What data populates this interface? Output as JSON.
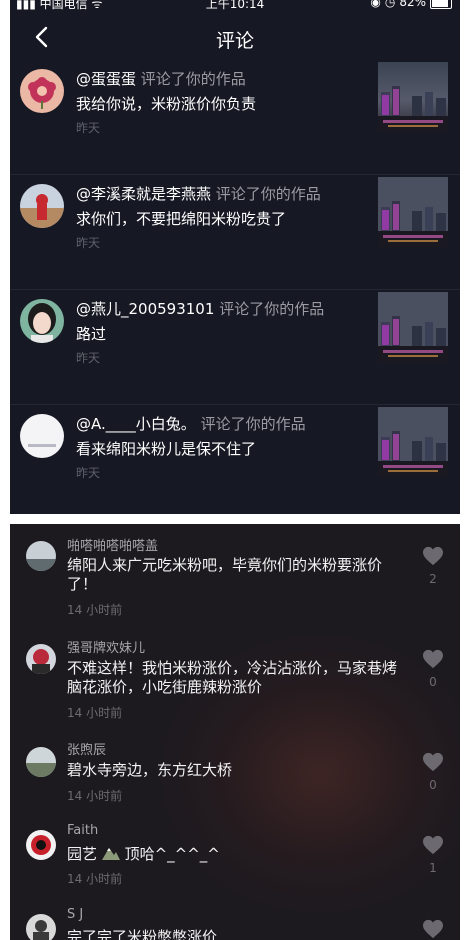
{
  "status_bar": {
    "carrier": "中国电信",
    "time": "上午10:14",
    "battery": "82%"
  },
  "header": {
    "title": "评论"
  },
  "notifications": [
    {
      "user": "@蛋蛋蛋",
      "action": "评论了你的作品",
      "comment": "我给你说，米粉涨价你负责",
      "time": "昨天"
    },
    {
      "user": "@李溪柔就是李燕燕",
      "action": "评论了你的作品",
      "comment": "求你们，不要把绵阳米粉吃贵了",
      "time": "昨天"
    },
    {
      "user": "@燕儿_200593101",
      "action": "评论了你的作品",
      "comment": "路过",
      "time": "昨天"
    },
    {
      "user": "@A.____小白兔。",
      "action": "评论了你的作品",
      "comment": "看来绵阳米粉儿是保不住了",
      "time": "昨天"
    }
  ],
  "comments": [
    {
      "name": "啪嗒啪嗒啪嗒盖",
      "text": "绵阳人来广元吃米粉吧，毕竟你们的米粉要涨价了！",
      "time": "14 小时前",
      "likes": "2"
    },
    {
      "name": "强哥牌欢妹儿",
      "text": "不难这样！我怕米粉涨价，冷沾沾涨价，马家巷烤脑花涨价，小吃街鹿辣粉涨价",
      "time": "14 小时前",
      "likes": "0"
    },
    {
      "name": "张煦辰",
      "text": "碧水寺旁边，东方红大桥",
      "time": "14 小时前",
      "likes": "0"
    },
    {
      "name": "Faith",
      "text_a": "园艺",
      "text_b": "顶哈^_^^_^",
      "time": "14 小时前",
      "likes": "1"
    },
    {
      "name": "S J",
      "text": "完了完了米粉憋憋涨价"
    }
  ],
  "icons": {
    "back": "chevron-left-icon",
    "like": "heart-icon"
  },
  "colors": {
    "panel_bg": "#161823",
    "comment_bg": "#1c1a1f",
    "text_primary": "#ffffff",
    "text_secondary": "#9b9ba3"
  }
}
